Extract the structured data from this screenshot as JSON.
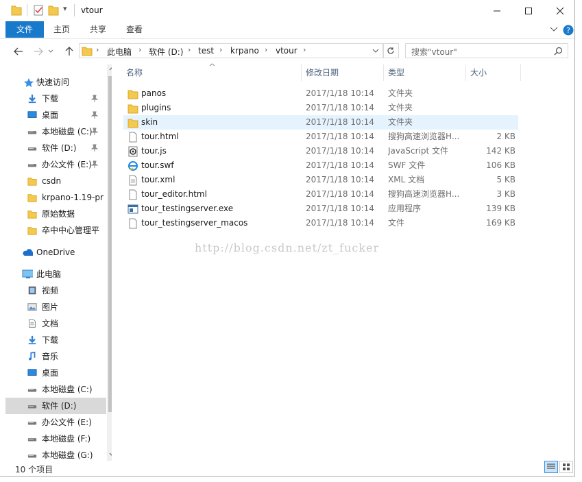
{
  "window": {
    "title": "vtour",
    "qat_dropdown": "▾"
  },
  "ribbon": {
    "tabs": [
      "文件",
      "主页",
      "共享",
      "查看"
    ]
  },
  "address": {
    "crumbs": [
      "此电脑",
      "软件 (D:)",
      "test",
      "krpano",
      "vtour"
    ],
    "search_placeholder": "搜索\"vtour\""
  },
  "nav": {
    "quick_access": "快速访问",
    "items": [
      {
        "label": "下载",
        "icon": "download-icon",
        "pinned": true
      },
      {
        "label": "桌面",
        "icon": "desktop-icon",
        "pinned": true
      },
      {
        "label": "本地磁盘 (C:)",
        "icon": "drive-icon",
        "pinned": true
      },
      {
        "label": "软件 (D:)",
        "icon": "drive-icon",
        "pinned": true
      },
      {
        "label": "办公文件 (E:)",
        "icon": "drive-icon",
        "pinned": true
      },
      {
        "label": "csdn",
        "icon": "folder-icon",
        "pinned": false
      },
      {
        "label": "krpano-1.19-pr",
        "icon": "folder-icon",
        "pinned": false
      },
      {
        "label": "原始数据",
        "icon": "folder-icon",
        "pinned": false
      },
      {
        "label": "卒中中心管理平",
        "icon": "folder-icon",
        "pinned": false
      }
    ],
    "onedrive": "OneDrive",
    "this_pc": "此电脑",
    "pc_items": [
      {
        "label": "视频",
        "icon": "video-icon"
      },
      {
        "label": "图片",
        "icon": "picture-icon"
      },
      {
        "label": "文档",
        "icon": "document-icon"
      },
      {
        "label": "下载",
        "icon": "download-icon"
      },
      {
        "label": "音乐",
        "icon": "music-icon"
      },
      {
        "label": "桌面",
        "icon": "desktop-icon"
      },
      {
        "label": "本地磁盘 (C:)",
        "icon": "drive-icon"
      },
      {
        "label": "软件 (D:)",
        "icon": "drive-icon",
        "selected": true
      },
      {
        "label": "办公文件 (E:)",
        "icon": "drive-icon"
      },
      {
        "label": "本地磁盘 (F:)",
        "icon": "drive-icon"
      },
      {
        "label": "本地磁盘 (G:)",
        "icon": "drive-icon"
      }
    ]
  },
  "columns": [
    "名称",
    "修改日期",
    "类型",
    "大小"
  ],
  "files": [
    {
      "name": "panos",
      "date": "2017/1/18 10:14",
      "type": "文件夹",
      "size": "",
      "icon": "folder-icon"
    },
    {
      "name": "plugins",
      "date": "2017/1/18 10:14",
      "type": "文件夹",
      "size": "",
      "icon": "folder-icon"
    },
    {
      "name": "skin",
      "date": "2017/1/18 10:14",
      "type": "文件夹",
      "size": "",
      "icon": "folder-icon"
    },
    {
      "name": "tour.html",
      "date": "2017/1/18 10:14",
      "type": "搜狗高速浏览器H...",
      "size": "2 KB",
      "icon": "html-file-icon"
    },
    {
      "name": "tour.js",
      "date": "2017/1/18 10:14",
      "type": "JavaScript 文件",
      "size": "142 KB",
      "icon": "js-file-icon"
    },
    {
      "name": "tour.swf",
      "date": "2017/1/18 10:14",
      "type": "SWF 文件",
      "size": "106 KB",
      "icon": "swf-file-icon"
    },
    {
      "name": "tour.xml",
      "date": "2017/1/18 10:14",
      "type": "XML 文档",
      "size": "5 KB",
      "icon": "xml-file-icon"
    },
    {
      "name": "tour_editor.html",
      "date": "2017/1/18 10:14",
      "type": "搜狗高速浏览器H...",
      "size": "3 KB",
      "icon": "html-file-icon"
    },
    {
      "name": "tour_testingserver.exe",
      "date": "2017/1/18 10:14",
      "type": "应用程序",
      "size": "139 KB",
      "icon": "exe-file-icon"
    },
    {
      "name": "tour_testingserver_macos",
      "date": "2017/1/18 10:14",
      "type": "文件",
      "size": "169 KB",
      "icon": "file-icon"
    }
  ],
  "status": "10 个项目",
  "watermark": "http://blog.csdn.net/zt_fucker",
  "colors": {
    "accent": "#1979ca",
    "folder": "#f3c94f",
    "hover_row": "#e5f3ff"
  }
}
